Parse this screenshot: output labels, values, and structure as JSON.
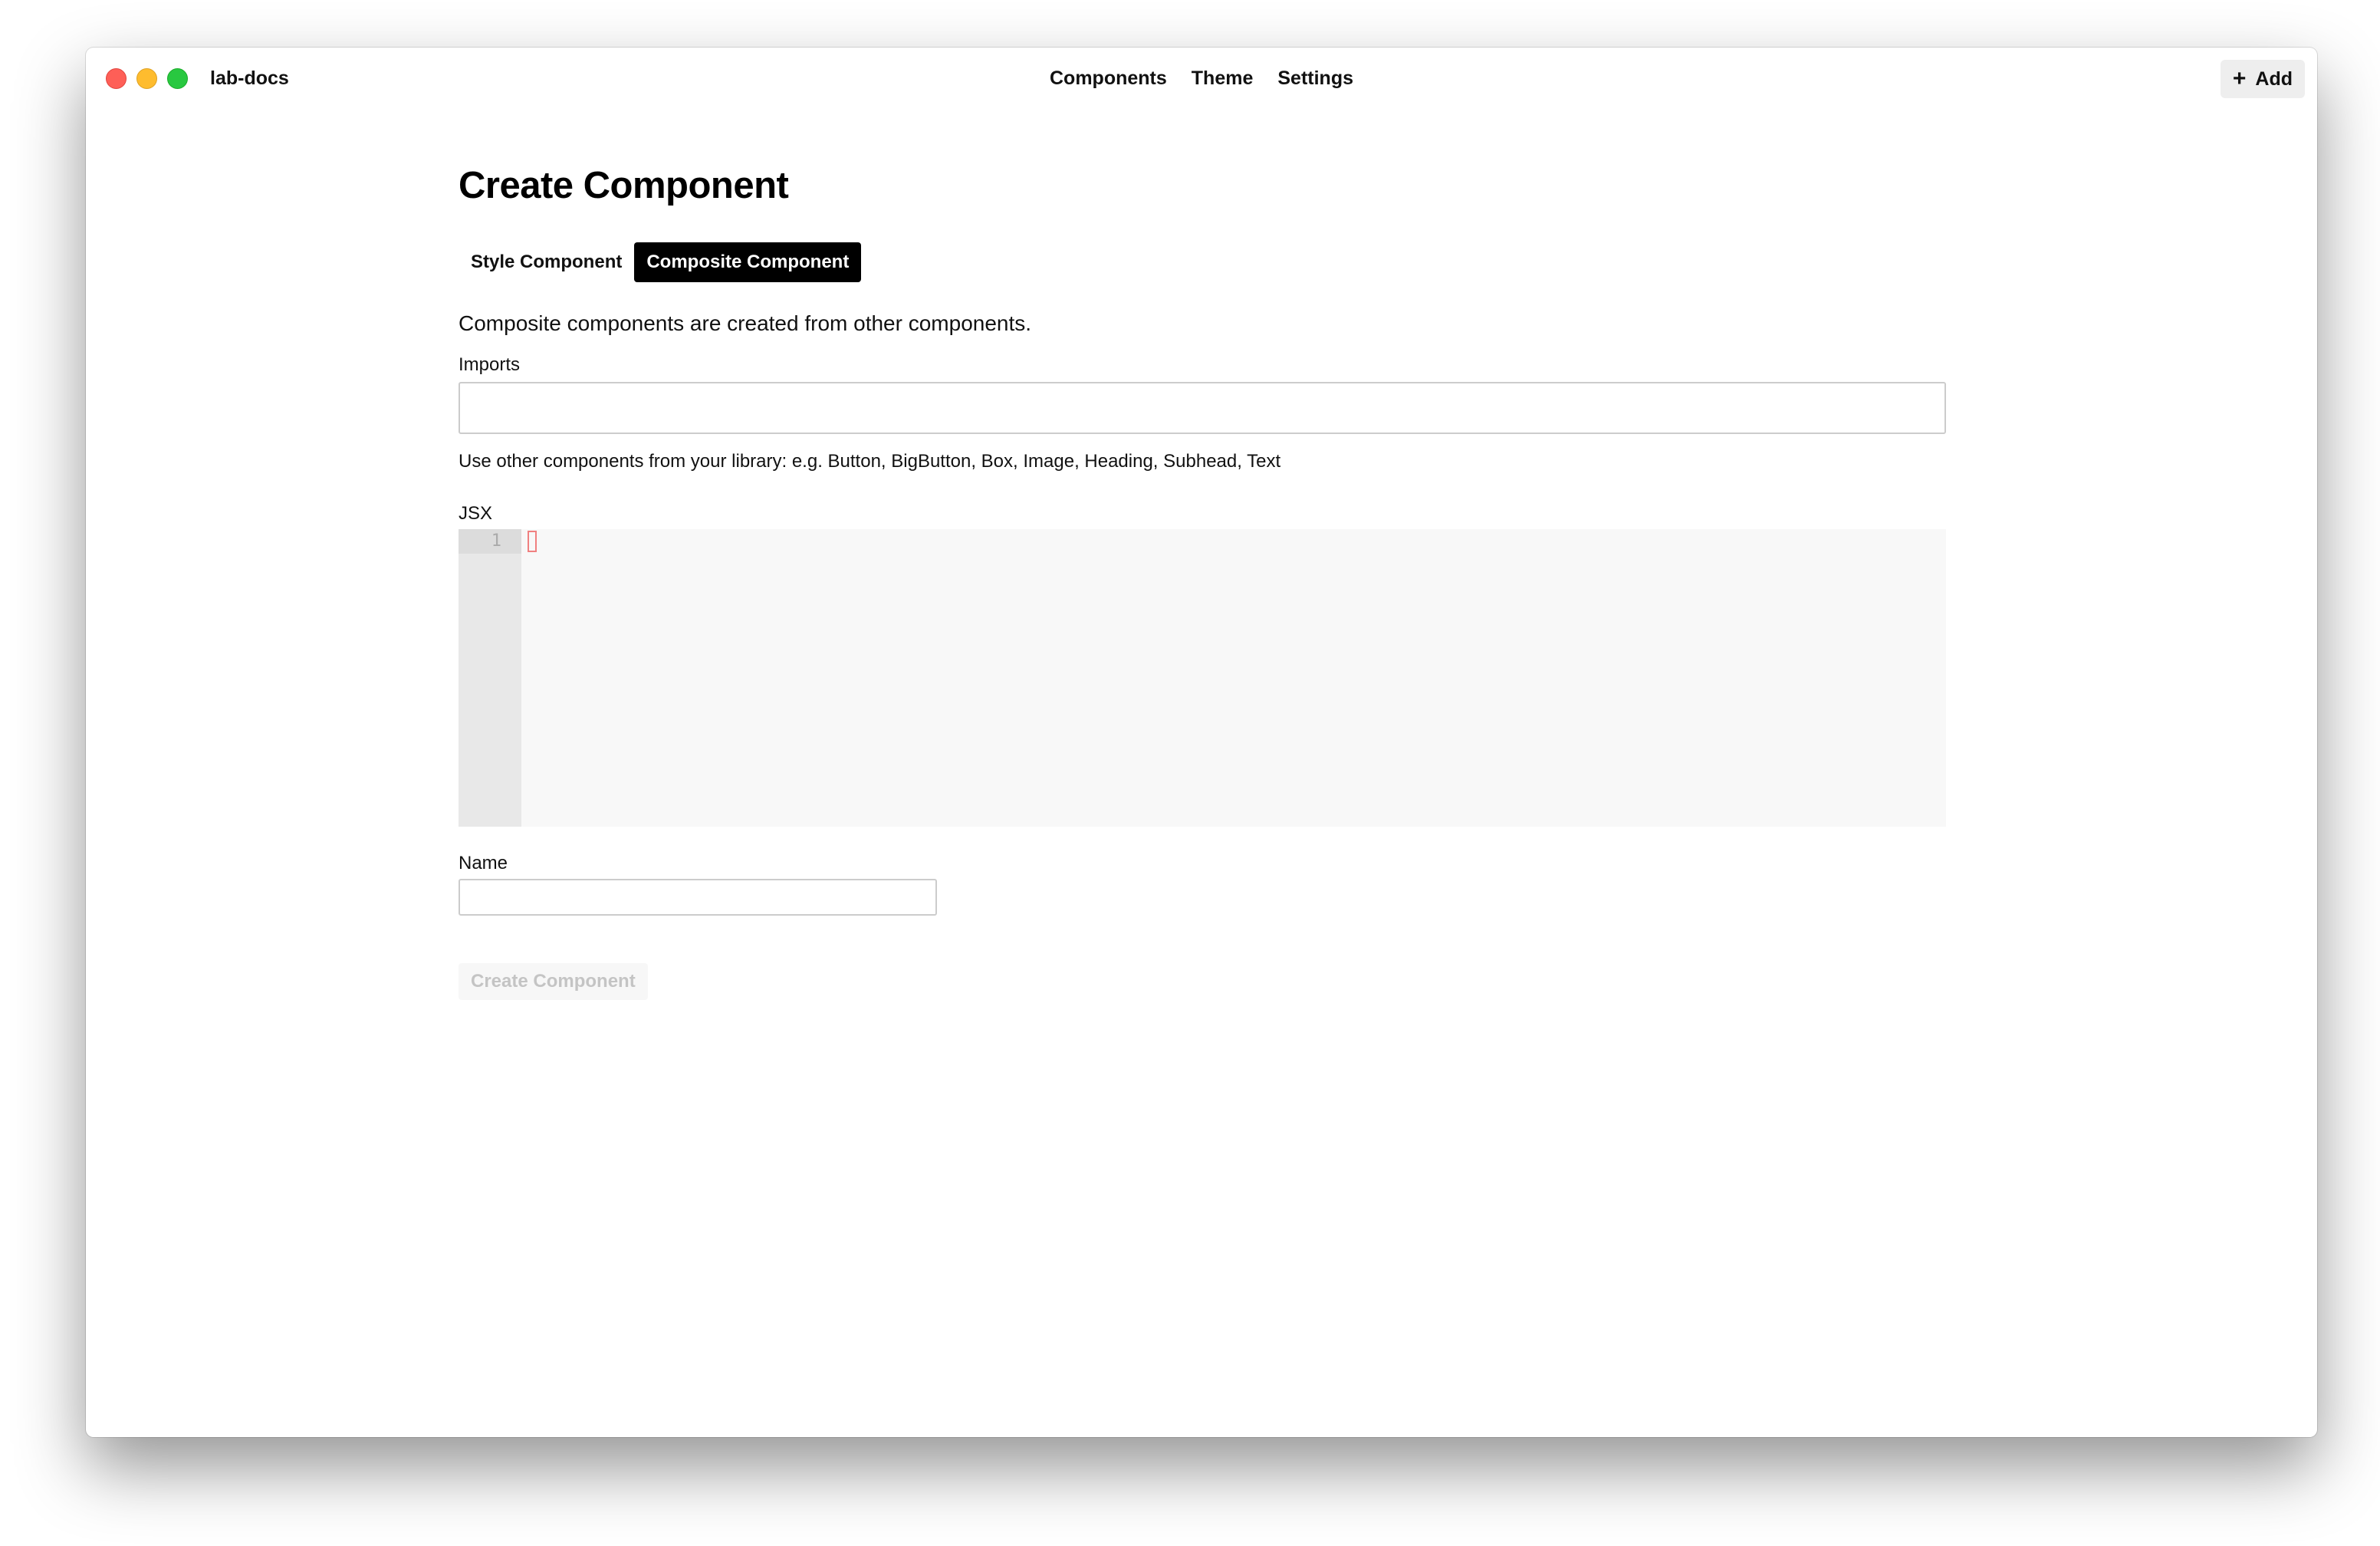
{
  "window": {
    "app_name": "lab-docs"
  },
  "nav": {
    "items": [
      {
        "label": "Components"
      },
      {
        "label": "Theme"
      },
      {
        "label": "Settings"
      }
    ],
    "add_icon": "+",
    "add_label": "Add"
  },
  "page": {
    "title": "Create Component",
    "tabs": [
      {
        "label": "Style Component",
        "active": false
      },
      {
        "label": "Composite Component",
        "active": true
      }
    ],
    "description": "Composite components are created from other components."
  },
  "form": {
    "imports_label": "Imports",
    "imports_value": "",
    "imports_hint": "Use other components from your library: e.g. Button, BigButton, Box, Image, Heading, Subhead, Text",
    "jsx_label": "JSX",
    "jsx_line_number": "1",
    "name_label": "Name",
    "name_value": "",
    "submit_label": "Create Component",
    "submit_disabled": true
  },
  "colors": {
    "traffic_close": "#fe5f57",
    "traffic_minimize": "#febc2e",
    "traffic_zoom": "#28c840",
    "active_tab_bg": "#000000",
    "cursor": "#f08080"
  }
}
